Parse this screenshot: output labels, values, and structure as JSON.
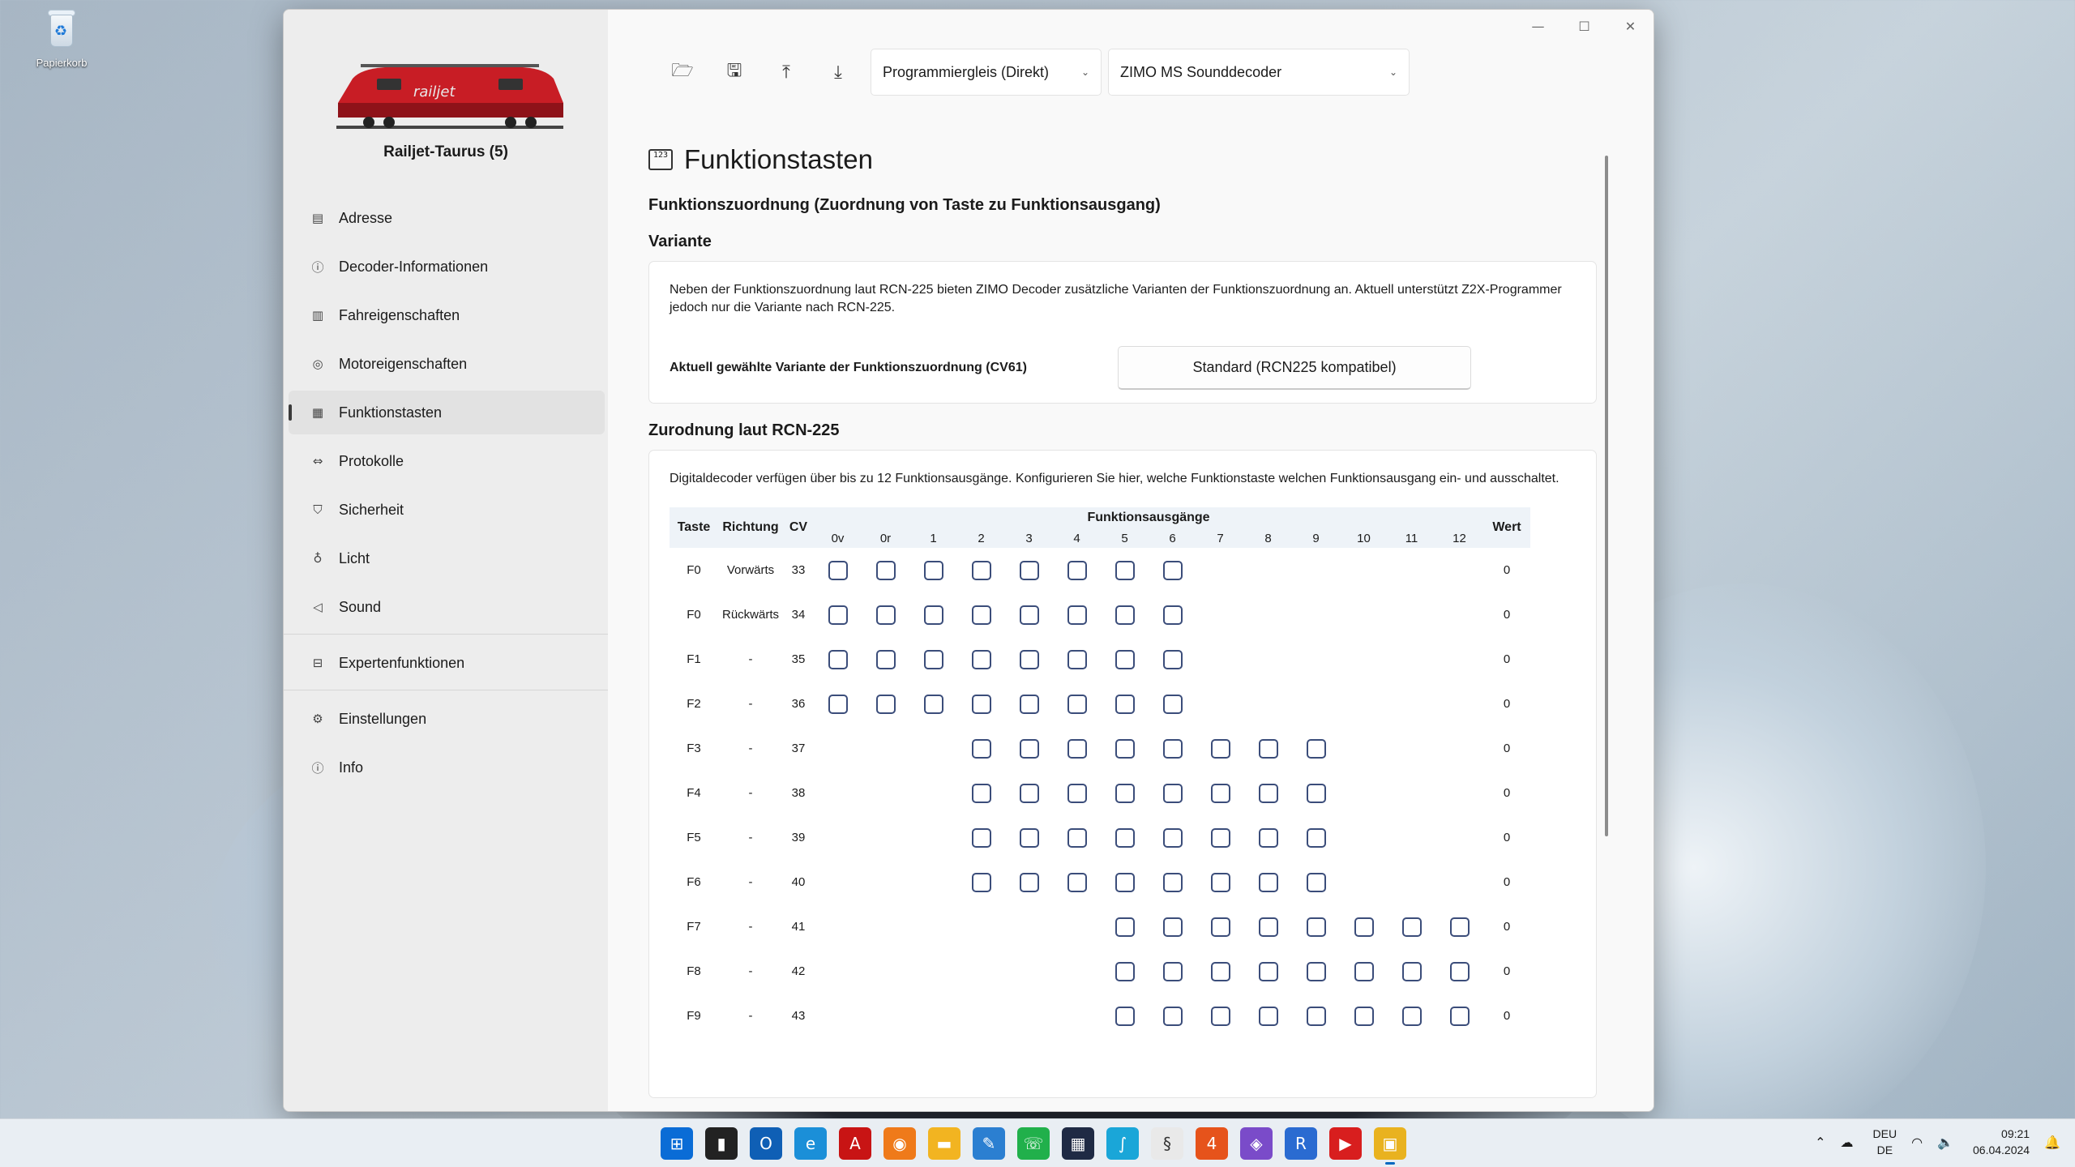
{
  "desktop": {
    "recycle_bin_label": "Papierkorb"
  },
  "window": {
    "loco_name": "Railjet-Taurus (5)",
    "titlebar": {
      "minimize": "—",
      "maximize": "☐",
      "close": "✕"
    }
  },
  "sidebar": {
    "items": [
      {
        "label": "Adresse",
        "icon": "address-icon"
      },
      {
        "label": "Decoder-Informationen",
        "icon": "info-icon"
      },
      {
        "label": "Fahreigenschaften",
        "icon": "driving-icon"
      },
      {
        "label": "Motoreigenschaften",
        "icon": "motor-icon"
      },
      {
        "label": "Funktionstasten",
        "icon": "function-keys-icon",
        "active": true
      },
      {
        "label": "Protokolle",
        "icon": "protocol-icon"
      },
      {
        "label": "Sicherheit",
        "icon": "shield-icon"
      },
      {
        "label": "Licht",
        "icon": "light-icon"
      },
      {
        "label": "Sound",
        "icon": "speaker-icon"
      }
    ],
    "expert_label": "Expertenfunktionen",
    "settings_label": "Einstellungen",
    "info_label": "Info"
  },
  "toolbar": {
    "track_select": "Programmiergleis (Direkt)",
    "decoder_select": "ZIMO MS Sounddecoder"
  },
  "page": {
    "title": "Funktionstasten",
    "subtitle": "Funktionszuordnung (Zuordnung von Taste zu Funktionsausgang)",
    "variant_heading": "Variante",
    "variant_text": "Neben der Funktionszuordnung laut RCN-225 bieten ZIMO Decoder zusätzliche Varianten der Funktionszuordnung an. Aktuell unterstützt Z2X-Programmer jedoch nur die Variante nach RCN-225.",
    "variant_label": "Aktuell gewählte Variante der Funktionszuordnung (CV61)",
    "variant_value": "Standard (RCN225 kompatibel)",
    "mapping_heading": "Zurodnung laut RCN-225",
    "mapping_text": "Digitaldecoder verfügen über bis zu 12 Funktionsausgänge. Konfigurieren Sie hier, welche Funktionstaste welchen Funktionsausgang ein- und ausschaltet."
  },
  "table": {
    "headers": {
      "key": "Taste",
      "direction": "Richtung",
      "cv": "CV",
      "outputs": "Funktionsausgänge",
      "value": "Wert"
    },
    "outputs": [
      "0v",
      "0r",
      "1",
      "2",
      "3",
      "4",
      "5",
      "6",
      "7",
      "8",
      "9",
      "10",
      "11",
      "12"
    ],
    "rows": [
      {
        "key": "F0",
        "direction": "Vorwärts",
        "cv": "33",
        "value": "0",
        "checks": [
          0,
          1,
          2,
          3,
          4,
          5,
          6,
          7
        ]
      },
      {
        "key": "F0",
        "direction": "Rückwärts",
        "cv": "34",
        "value": "0",
        "checks": [
          0,
          1,
          2,
          3,
          4,
          5,
          6,
          7
        ]
      },
      {
        "key": "F1",
        "direction": "-",
        "cv": "35",
        "value": "0",
        "checks": [
          0,
          1,
          2,
          3,
          4,
          5,
          6,
          7
        ]
      },
      {
        "key": "F2",
        "direction": "-",
        "cv": "36",
        "value": "0",
        "checks": [
          0,
          1,
          2,
          3,
          4,
          5,
          6,
          7
        ]
      },
      {
        "key": "F3",
        "direction": "-",
        "cv": "37",
        "value": "0",
        "checks": [
          3,
          4,
          5,
          6,
          7,
          8,
          9,
          10
        ]
      },
      {
        "key": "F4",
        "direction": "-",
        "cv": "38",
        "value": "0",
        "checks": [
          3,
          4,
          5,
          6,
          7,
          8,
          9,
          10
        ]
      },
      {
        "key": "F5",
        "direction": "-",
        "cv": "39",
        "value": "0",
        "checks": [
          3,
          4,
          5,
          6,
          7,
          8,
          9,
          10
        ]
      },
      {
        "key": "F6",
        "direction": "-",
        "cv": "40",
        "value": "0",
        "checks": [
          3,
          4,
          5,
          6,
          7,
          8,
          9,
          10
        ]
      },
      {
        "key": "F7",
        "direction": "-",
        "cv": "41",
        "value": "0",
        "checks": [
          6,
          7,
          8,
          9,
          10,
          11,
          12,
          13
        ]
      },
      {
        "key": "F8",
        "direction": "-",
        "cv": "42",
        "value": "0",
        "checks": [
          6,
          7,
          8,
          9,
          10,
          11,
          12,
          13
        ]
      },
      {
        "key": "F9",
        "direction": "-",
        "cv": "43",
        "value": "0",
        "checks": [
          6,
          7,
          8,
          9,
          10,
          11,
          12,
          13
        ]
      }
    ]
  },
  "taskbar": {
    "apps": [
      {
        "name": "start-icon",
        "glyph": "⊞",
        "color": "#0a6cd6"
      },
      {
        "name": "task-view-icon",
        "glyph": "▮",
        "color": "#222222"
      },
      {
        "name": "outlook-icon",
        "glyph": "O",
        "color": "#0f5fb5"
      },
      {
        "name": "edge-icon",
        "glyph": "e",
        "color": "#1b8fd8"
      },
      {
        "name": "acrobat-icon",
        "glyph": "A",
        "color": "#c81414"
      },
      {
        "name": "firefox-icon",
        "glyph": "◉",
        "color": "#ef7a1a"
      },
      {
        "name": "explorer-icon",
        "glyph": "▬",
        "color": "#f2b421"
      },
      {
        "name": "paint-icon",
        "glyph": "✎",
        "color": "#2b7fd1"
      },
      {
        "name": "whatsapp-icon",
        "glyph": "☏",
        "color": "#21b04b"
      },
      {
        "name": "app-dark-icon",
        "glyph": "▦",
        "color": "#1f2a44"
      },
      {
        "name": "app-teal-icon",
        "glyph": "∫",
        "color": "#1aa6d8"
      },
      {
        "name": "app-white-icon",
        "glyph": "§",
        "color": "#e9e9e9"
      },
      {
        "name": "app-orange-icon",
        "glyph": "4",
        "color": "#e6531b"
      },
      {
        "name": "visual-studio-icon",
        "glyph": "◈",
        "color": "#7a4bc9"
      },
      {
        "name": "app-blue-icon",
        "glyph": "R",
        "color": "#2a6bd1"
      },
      {
        "name": "media-player-icon",
        "glyph": "▶",
        "color": "#d81e1e"
      },
      {
        "name": "z2x-programmer-icon",
        "glyph": "▣",
        "color": "#e9b21f",
        "active": true
      }
    ],
    "tray": {
      "chevron": "⌃",
      "cloud": "☁",
      "lang_top": "DEU",
      "lang_bottom": "DE",
      "wifi": "◠",
      "volume": "🔈",
      "time": "09:21",
      "date": "06.04.2024",
      "bell": "🔔"
    }
  }
}
